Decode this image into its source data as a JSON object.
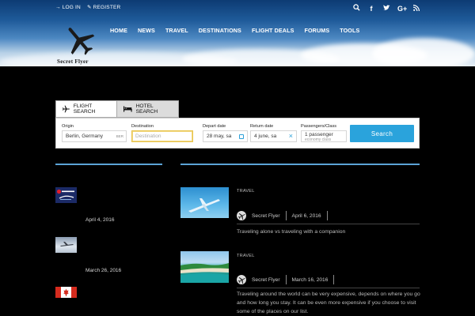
{
  "topbar": {
    "login": "LOG IN",
    "register": "REGISTER"
  },
  "social": [
    "search-icon",
    "facebook-icon",
    "twitter-icon",
    "google-plus-icon",
    "rss-icon"
  ],
  "logo": {
    "text": "Secret Flyer"
  },
  "nav": [
    "HOME",
    "NEWS",
    "TRAVEL",
    "DESTINATIONS",
    "FLIGHT DEALS",
    "FORUMS",
    "TOOLS"
  ],
  "search": {
    "tabs": {
      "flight": "FLIGHT SEARCH",
      "hotel": "HOTEL SEARCH"
    },
    "origin": {
      "label": "Origin",
      "value": "Berlin, Germany",
      "code": "BER"
    },
    "destination": {
      "label": "Destination",
      "placeholder": "Destination"
    },
    "depart": {
      "label": "Depart date",
      "value": "28 may, sa"
    },
    "return": {
      "label": "Return date",
      "value": "4 june, sa"
    },
    "passengers": {
      "label": "Passengers/Class",
      "value": "1 passenger",
      "class": "economy class"
    },
    "button": "Search"
  },
  "sidebar": {
    "items": [
      {
        "date": "April 4, 2016",
        "thumb": "virgin-atlantic-alaska-logo"
      },
      {
        "date": "March 26, 2016",
        "thumb": "airplane-in-clouds"
      },
      {
        "date": "",
        "thumb": "canada-flag"
      }
    ]
  },
  "posts": [
    {
      "category": "TRAVEL",
      "author": "Secret Flyer",
      "date": "April 6, 2016",
      "excerpt": "Traveling alone vs traveling with a companion"
    },
    {
      "category": "TRAVEL",
      "author": "Secret Flyer",
      "date": "March 16, 2016",
      "excerpt": "Traveling around the world can be very expensive, depends on where you go and how long you stay. It can be even more expensive if you choose to visit some of the places on our list."
    }
  ],
  "colors": {
    "accent": "#2aa3dc",
    "rule": "#5ba3d6",
    "background": "#000000"
  }
}
